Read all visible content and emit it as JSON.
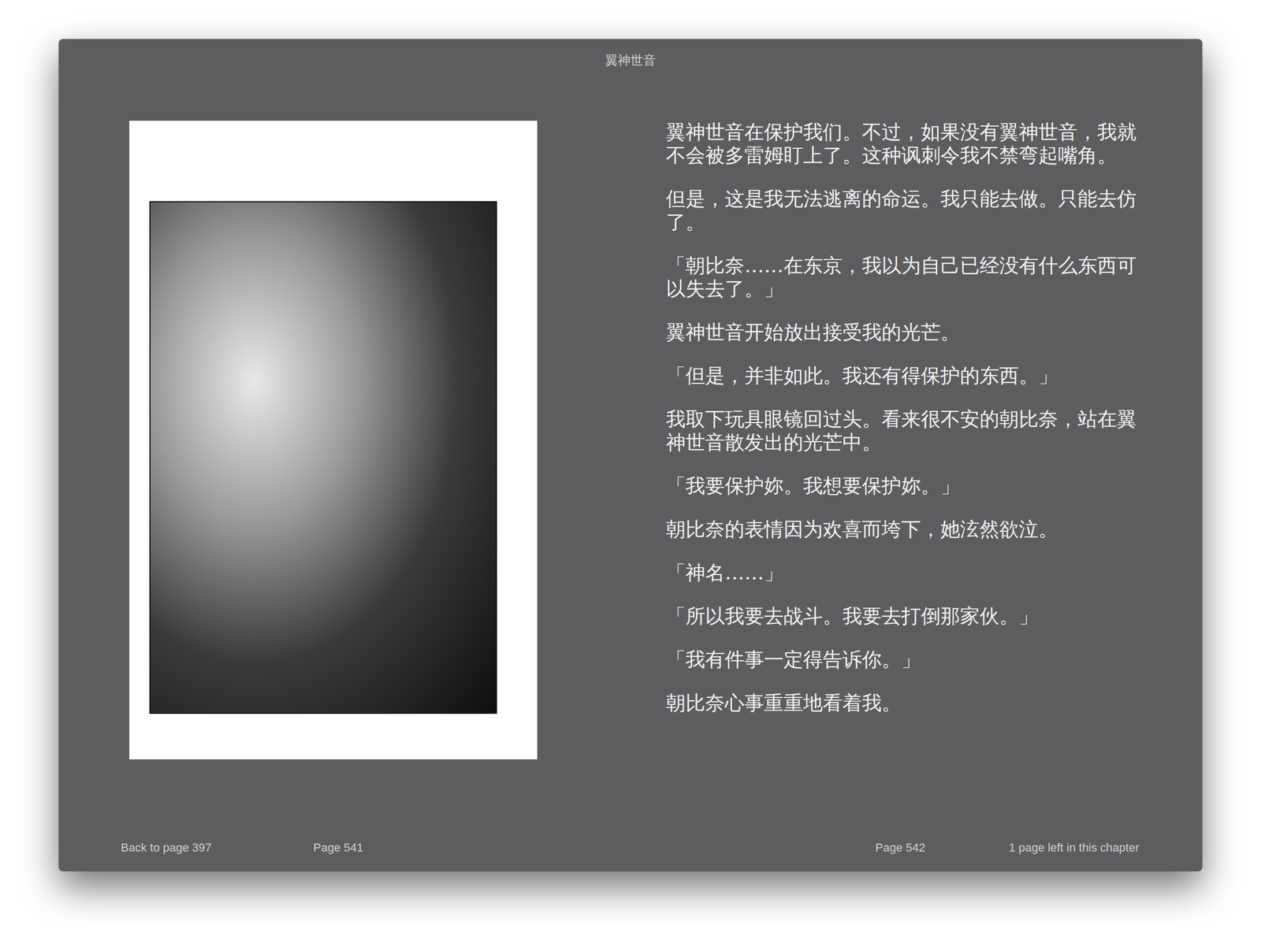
{
  "window": {
    "title": "翼神世音"
  },
  "page": {
    "paragraphs": [
      "翼神世音在保护我们。不过，如果没有翼神世音，我就不会被多雷姆盯上了。这种讽刺令我不禁弯起嘴角。",
      "但是，这是我无法逃离的命运。我只能去做。只能去仿了。",
      "「朝比奈……在东京，我以为自己已经没有什么东西可以失去了。」",
      "翼神世音开始放出接受我的光芒。",
      "「但是，并非如此。我还有得保护的东西。」",
      "我取下玩具眼镜回过头。看来很不安的朝比奈，站在翼神世音散发出的光芒中。",
      "「我要保护妳。我想要保护妳。」",
      "朝比奈的表情因为欢喜而垮下，她泫然欲泣。",
      "「神名……」",
      "「所以我要去战斗。我要去打倒那家伙。」",
      "「我有件事一定得告诉你。」",
      "朝比奈心事重重地看着我。"
    ]
  },
  "footer": {
    "back_link": "Back to page 397",
    "left_page": "Page 541",
    "right_page": "Page 542",
    "remaining": "1 page left in this chapter"
  }
}
